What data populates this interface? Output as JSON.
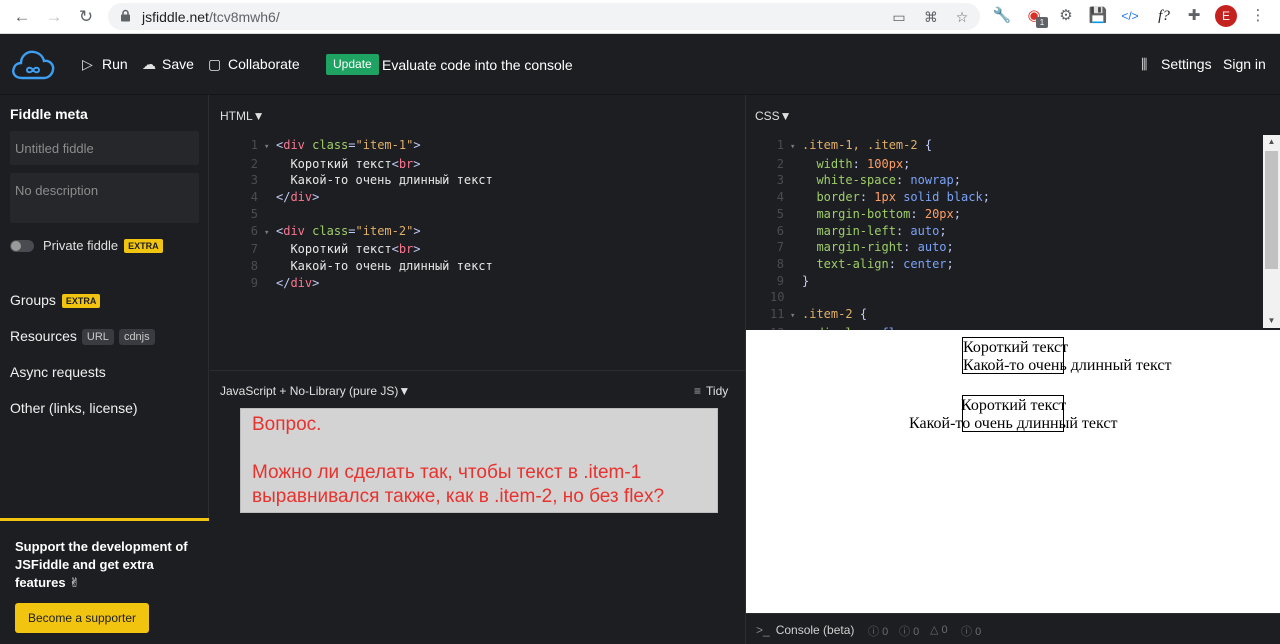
{
  "browser": {
    "url_host": "jsfiddle.net",
    "url_path": "/tcv8mwh6/",
    "badge_count": "1",
    "avatar_letter": "E",
    "ext_f": "f?"
  },
  "header": {
    "run": "Run",
    "save": "Save",
    "collaborate": "Collaborate",
    "update_badge": "Update",
    "update_text": "Evaluate code into the console",
    "settings": "Settings",
    "sign_in": "Sign in"
  },
  "sidebar": {
    "title": "Fiddle meta",
    "title_placeholder": "Untitled fiddle",
    "description_placeholder": "No description",
    "private_label": "Private fiddle",
    "extra": "EXTRA",
    "groups": "Groups",
    "resources": "Resources",
    "resources_tags": [
      "URL",
      "cdnjs"
    ],
    "async": "Async requests",
    "other": "Other (links, license)",
    "support_text": "Support the development of JSFiddle and get extra features ✌",
    "support_button": "Become a supporter"
  },
  "html_panel": {
    "label": "HTML▼"
  },
  "css_panel": {
    "label": "CSS▼"
  },
  "js_panel": {
    "label": "JavaScript + No-Library (pure JS)▼",
    "tidy": "Tidy",
    "question": "Вопрос.\n\nМожно ли сделать так, чтобы текст в .item-1 выравнивался также, как в .item-2, но без flex?"
  },
  "result": {
    "line1": "Короткий текст",
    "line2": "Какой-то очень длинный текст"
  },
  "console": {
    "label": "Console (beta)",
    "counts": [
      "0",
      "0",
      "0",
      "0"
    ]
  },
  "colors": {
    "accent_update": "#1ea362",
    "accent_extra": "#f1c40f",
    "question_red": "#e8322e"
  }
}
